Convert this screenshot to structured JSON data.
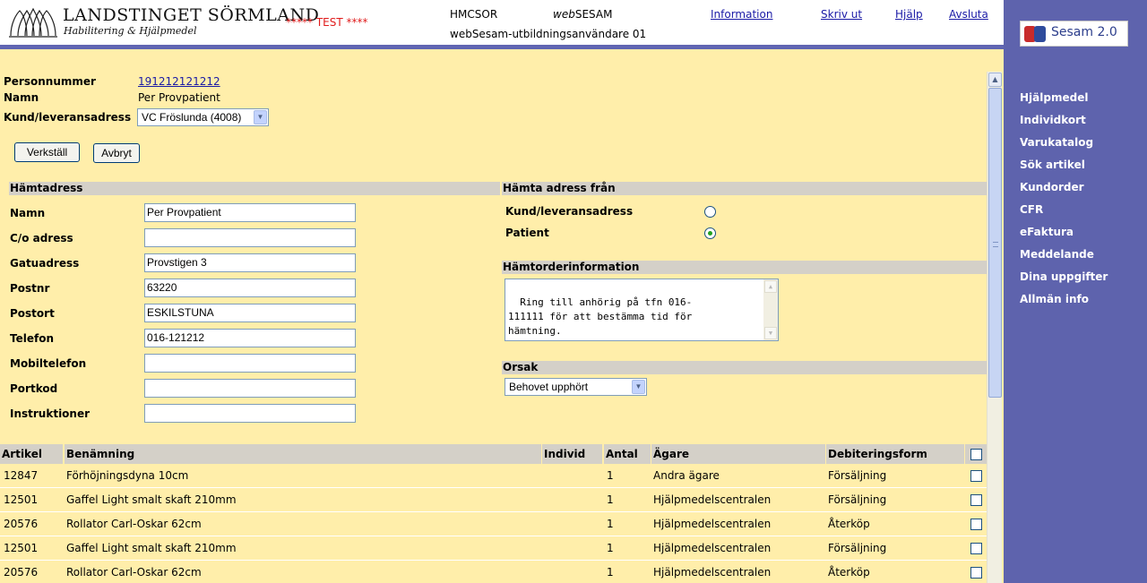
{
  "header": {
    "logo_title": "LANDSTINGET SÖRMLAND",
    "logo_subtitle": "Habilitering & Hjälpmedel",
    "test_banner": "***** TEST ****",
    "system_code": "HMCSOR",
    "app_name_prefix": "web",
    "app_name": "SESAM",
    "user": "webSesam-utbildningsanvändare 01",
    "links": {
      "information": "Information",
      "print": "Skriv ut",
      "help": "Hjälp",
      "logout": "Avsluta"
    }
  },
  "sidebar": {
    "logo_text": "Sesam 2.0",
    "items": [
      "Hjälpmedel",
      "Individkort",
      "Varukatalog",
      "Sök artikel",
      "Kundorder",
      "CFR",
      "eFaktura",
      "Meddelande",
      "Dina uppgifter",
      "Allmän info"
    ]
  },
  "patient": {
    "pnr_label": "Personnummer",
    "pnr_value": "191212121212",
    "name_label": "Namn",
    "name_value": "Per Provpatient",
    "customer_label": "Kund/leveransadress",
    "customer_value": "VC Fröslunda (4008)"
  },
  "actions": {
    "apply": "Verkställ",
    "cancel": "Avbryt"
  },
  "pickup": {
    "title": "Hämtadress",
    "fields": [
      {
        "label": "Namn",
        "value": "Per Provpatient"
      },
      {
        "label": "C/o adress",
        "value": ""
      },
      {
        "label": "Gatuadress",
        "value": "Provstigen 3"
      },
      {
        "label": "Postnr",
        "value": "63220"
      },
      {
        "label": "Postort",
        "value": "ESKILSTUNA"
      },
      {
        "label": "Telefon",
        "value": "016-121212"
      },
      {
        "label": "Mobiltelefon",
        "value": ""
      },
      {
        "label": "Portkod",
        "value": ""
      },
      {
        "label": "Instruktioner",
        "value": ""
      }
    ]
  },
  "source": {
    "title": "Hämta adress från",
    "options": [
      {
        "label": "Kund/leveransadress",
        "selected": false
      },
      {
        "label": "Patient",
        "selected": true
      }
    ]
  },
  "order_info": {
    "title": "Hämtorderinformation",
    "text": "Ring till anhörig på tfn 016-\n111111 för att bestämma tid för\nhämtning.\nMvh Tessan Testförskrivare"
  },
  "reason": {
    "title": "Orsak",
    "value": "Behovet upphört"
  },
  "table": {
    "headers": [
      "Artikel",
      "Benämning",
      "Individ",
      "Antal",
      "Ägare",
      "Debiteringsform"
    ],
    "rows": [
      {
        "article": "12847",
        "name": "Förhöjningsdyna 10cm",
        "individ": "",
        "qty": "1",
        "owner": "Andra ägare",
        "billing": "Försäljning"
      },
      {
        "article": "12501",
        "name": "Gaffel Light smalt skaft 210mm",
        "individ": "",
        "qty": "1",
        "owner": "Hjälpmedelscentralen",
        "billing": "Försäljning"
      },
      {
        "article": "20576",
        "name": "Rollator Carl-Oskar 62cm",
        "individ": "",
        "qty": "1",
        "owner": "Hjälpmedelscentralen",
        "billing": "Återköp"
      },
      {
        "article": "12501",
        "name": "Gaffel Light smalt skaft 210mm",
        "individ": "",
        "qty": "1",
        "owner": "Hjälpmedelscentralen",
        "billing": "Försäljning"
      },
      {
        "article": "20576",
        "name": "Rollator Carl-Oskar 62cm",
        "individ": "",
        "qty": "1",
        "owner": "Hjälpmedelscentralen",
        "billing": "Återköp"
      }
    ]
  },
  "colors": {
    "sidebar": "#5e63ad",
    "page": "#ffeeaa",
    "section_bar": "#d4d0c8",
    "test_banner": "#e01b1b",
    "link": "#1a1aa6"
  }
}
